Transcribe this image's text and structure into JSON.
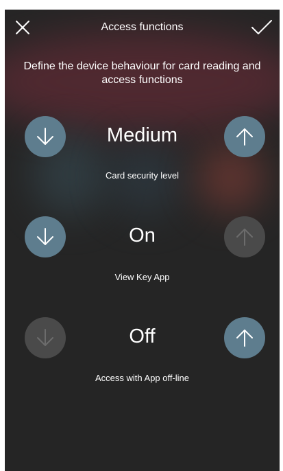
{
  "header": {
    "title": "Access functions"
  },
  "description": "Define the device behaviour for card reading and access functions",
  "settings": [
    {
      "value": "Medium",
      "label": "Card security level",
      "down_enabled": true,
      "up_enabled": true
    },
    {
      "value": "On",
      "label": "View Key App",
      "down_enabled": true,
      "up_enabled": false
    },
    {
      "value": "Off",
      "label": "Access with App off-line",
      "down_enabled": false,
      "up_enabled": true
    }
  ],
  "colors": {
    "background": "#252525",
    "button_active": "#5e7d8e",
    "button_disabled": "#4a4a4a",
    "text": "#ffffff"
  },
  "icons": {
    "close": "close-icon",
    "confirm": "check-icon",
    "decrease": "arrow-down-icon",
    "increase": "arrow-up-icon"
  }
}
